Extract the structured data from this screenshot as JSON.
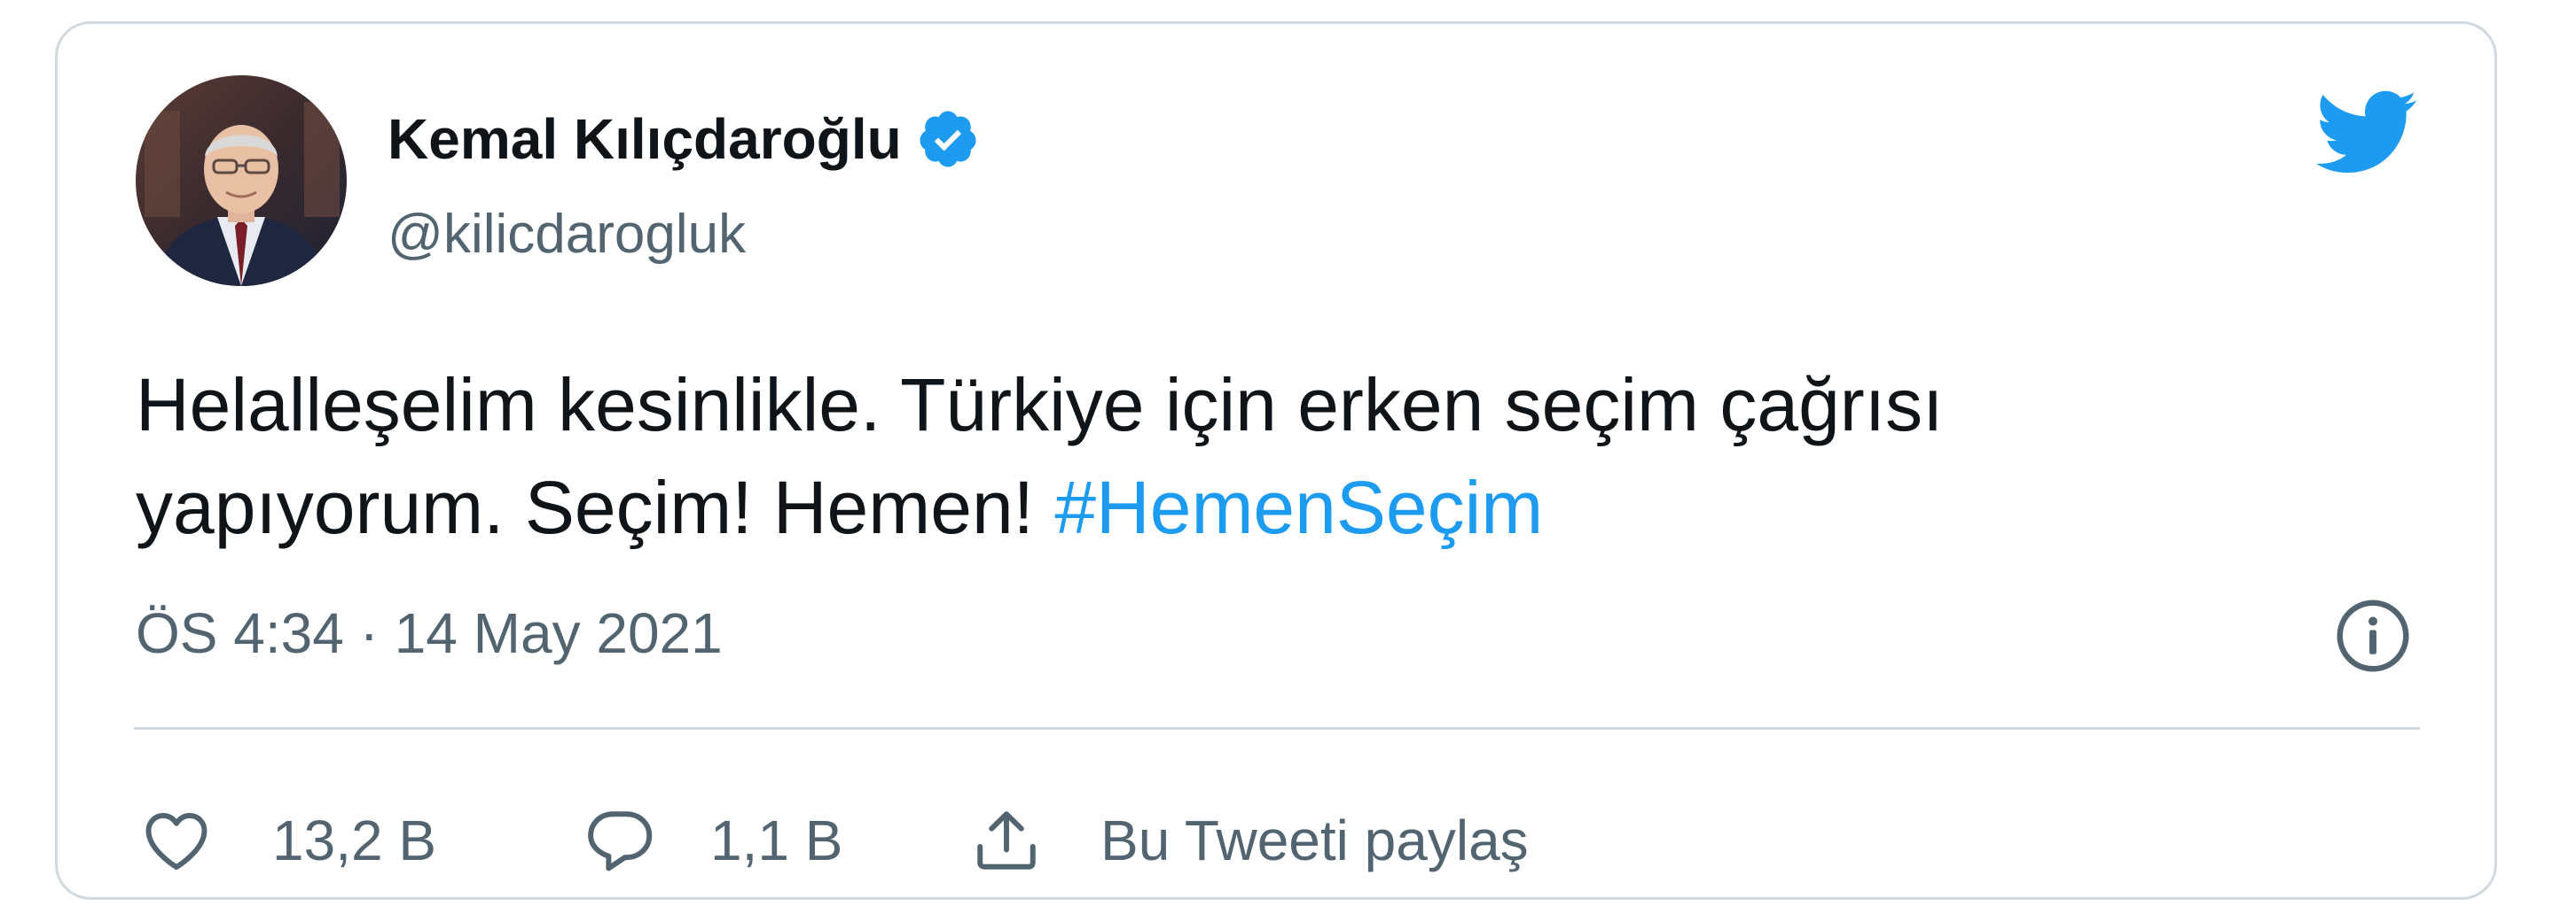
{
  "tweet": {
    "author": {
      "display_name": "Kemal Kılıçdaroğlu",
      "handle": "@kilicdarogluk",
      "verified": true
    },
    "text_line1": "Helalleşelim kesinlikle. Türkiye için erken seçim çağrısı",
    "text_line2_prefix": "yapıyorum. Seçim! Hemen! ",
    "hashtag": "#HemenSeçim",
    "time": "ÖS 4:34",
    "separator": "·",
    "date": "14 May 2021"
  },
  "actions": {
    "like_count": "13,2 B",
    "reply_count": "1,1 B",
    "share_label": "Bu Tweeti paylaş"
  },
  "icons": {
    "brand": "twitter-bird-icon",
    "verified": "verified-badge-icon",
    "info": "info-icon",
    "like": "heart-icon",
    "reply": "speech-bubble-icon",
    "share": "share-upload-icon"
  },
  "colors": {
    "brand_blue": "#1d9bf0",
    "text": "#0f1419",
    "muted": "#536471",
    "border": "#cfd9de"
  }
}
